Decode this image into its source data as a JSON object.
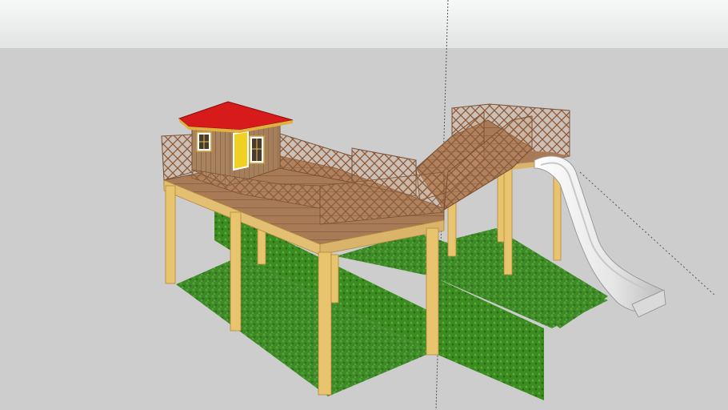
{
  "app": {
    "kind": "3d-modeling-viewport"
  },
  "colors": {
    "sky_top": "#f7f8f8",
    "sky_bottom": "#e4e6e6",
    "ground": "#cdcdcd",
    "grass_light": "#4f9a2f",
    "grass_dark": "#2f6e1c",
    "wood_post": "#e9c46e",
    "wood_post_shade": "#c99a3c",
    "deck_top": "#a87a56",
    "deck_edge": "#d9b46a",
    "lattice": "#8a5a3a",
    "house_wall": "#a9835f",
    "roof": "#d71a1a",
    "roof_trim": "#e0b040",
    "door": "#f0d020",
    "slide": "#eeeeee",
    "axis_line": "#444444"
  },
  "scene": {
    "objects": [
      "ground-plane",
      "grass-terrain",
      "raised-deck",
      "support-posts",
      "lattice-railing",
      "playhouse",
      "ramp",
      "tower-platform",
      "slide"
    ]
  }
}
